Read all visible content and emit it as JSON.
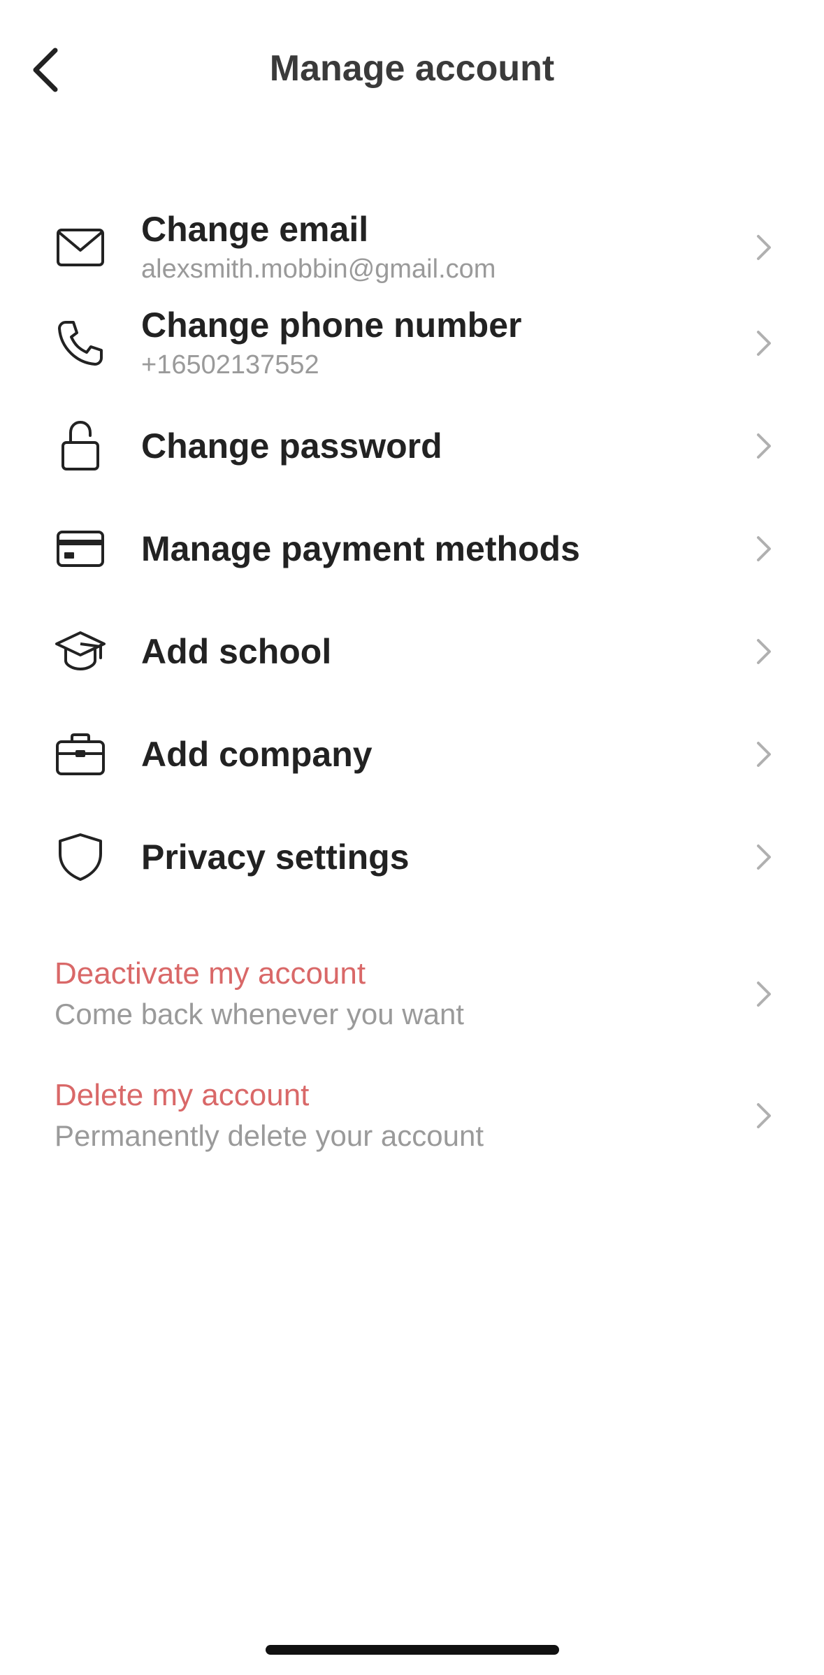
{
  "header": {
    "title": "Manage account",
    "back_icon": "chevron-left-icon"
  },
  "menu": {
    "items": [
      {
        "icon": "mail-icon",
        "label": "Change email",
        "sub": "alexsmith.mobbin@gmail.com"
      },
      {
        "icon": "phone-icon",
        "label": "Change phone number",
        "sub": "+16502137552"
      },
      {
        "icon": "unlock-icon",
        "label": "Change password"
      },
      {
        "icon": "credit-card-icon",
        "label": "Manage payment methods"
      },
      {
        "icon": "graduation-cap-icon",
        "label": "Add school"
      },
      {
        "icon": "briefcase-icon",
        "label": "Add company"
      },
      {
        "icon": "shield-icon",
        "label": "Privacy settings"
      }
    ]
  },
  "danger": {
    "deactivate": {
      "label": "Deactivate my account",
      "sub": "Come back whenever you want"
    },
    "delete": {
      "label": "Delete my account",
      "sub": "Permanently delete your account"
    }
  },
  "colors": {
    "danger_text": "#d96868",
    "secondary_text": "#9a9a9a",
    "primary_text": "#222222",
    "chevron": "#b0b0b0"
  }
}
